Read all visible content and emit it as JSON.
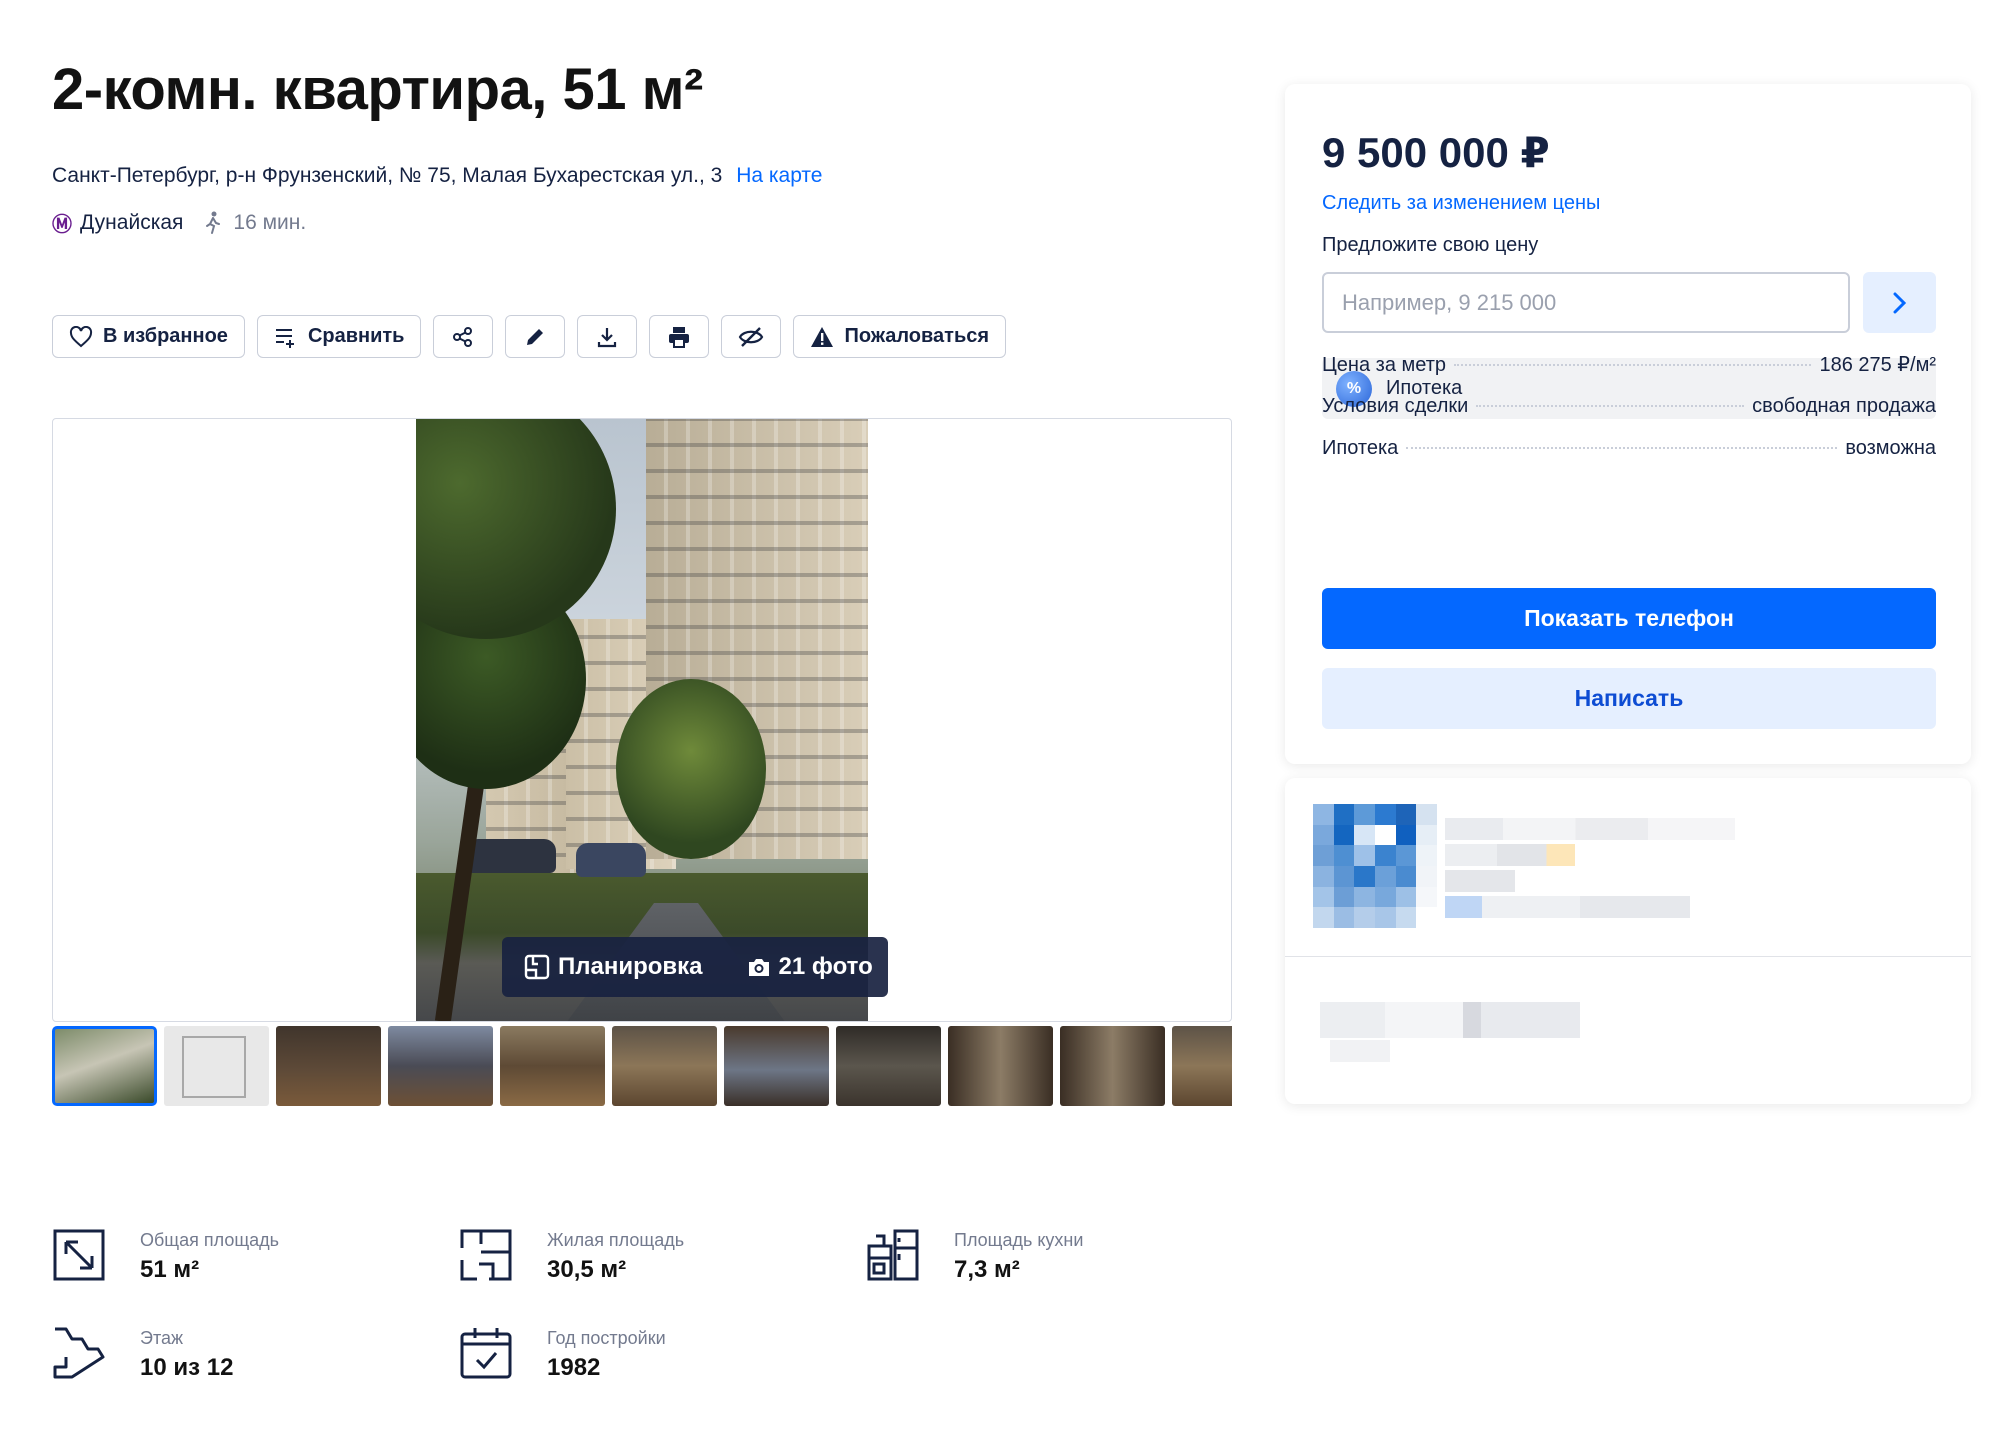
{
  "listing": {
    "title": "2-комн. квартира, 51 м²",
    "address": "Санкт-Петербург, р-н Фрунзенский, № 75, Малая Бухарестская ул., 3",
    "map_link": "На карте",
    "metro_name": "Дунайская",
    "walk_time": "16 мин."
  },
  "toolbar": {
    "favorite": "В избранное",
    "compare": "Сравнить",
    "report": "Пожаловаться",
    "icons": [
      "share-icon",
      "edit-icon",
      "download-icon",
      "print-icon",
      "hide-icon"
    ]
  },
  "gallery": {
    "layout_label": "Планировка",
    "photos_label": "21 фото",
    "thumbnails": [
      "exterior",
      "plan",
      "room",
      "room",
      "room",
      "room",
      "kitchen",
      "kitchen",
      "hallway",
      "hallway",
      "room"
    ]
  },
  "params": {
    "total_area": {
      "label": "Общая площадь",
      "value": "51 м²"
    },
    "living_area": {
      "label": "Жилая площадь",
      "value": "30,5 м²"
    },
    "kitchen_area": {
      "label": "Площадь кухни",
      "value": "7,3 м²"
    },
    "floor": {
      "label": "Этаж",
      "value": "10 из 12"
    },
    "year": {
      "label": "Год постройки",
      "value": "1982"
    }
  },
  "price_card": {
    "price": "9 500 000 ₽",
    "follow_price": "Следить за изменением цены",
    "offer_label": "Предложите свою цену",
    "offer_placeholder": "Например, 9 215 000",
    "mortgage_pill": "Ипотека",
    "rows": [
      {
        "label": "Цена за метр",
        "value": "186 275 ₽/м²"
      },
      {
        "label": "Условия сделки",
        "value": "свободная продажа"
      },
      {
        "label": "Ипотека",
        "value": "возможна"
      }
    ],
    "show_phone": "Показать телефон",
    "write": "Написать"
  },
  "colors": {
    "accent": "#0468ff",
    "text": "#152242",
    "metro": "#6a1e8f",
    "secondary_button": "#e5efff"
  }
}
